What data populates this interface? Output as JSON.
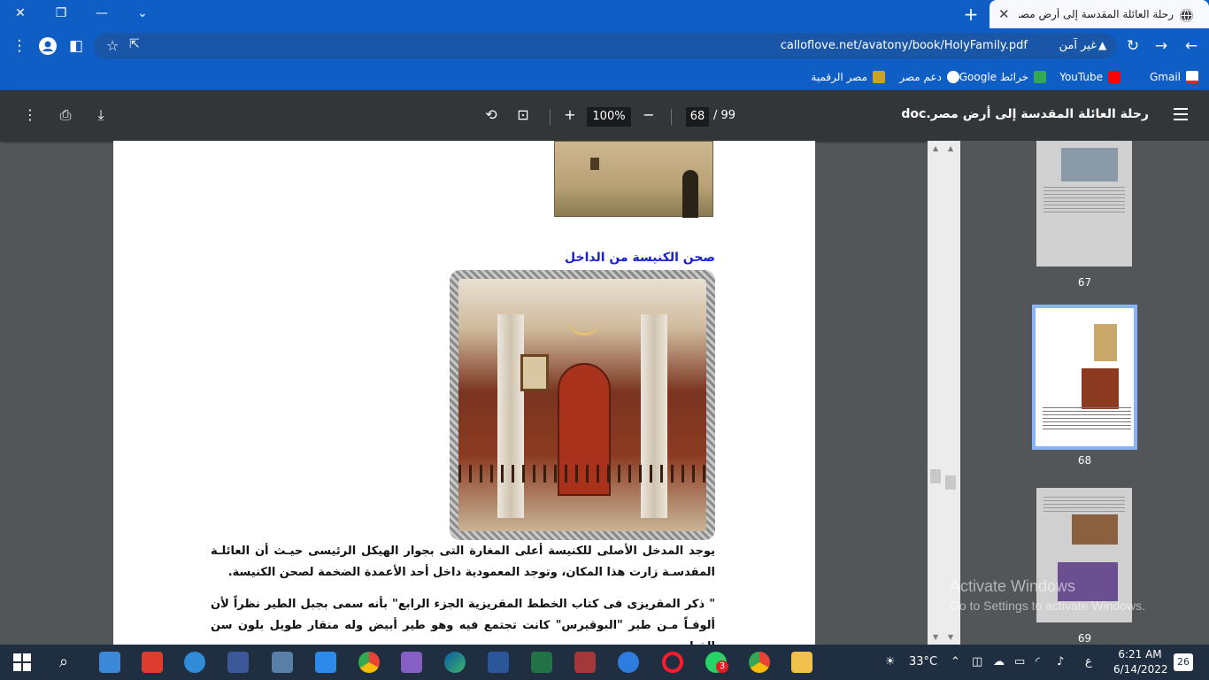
{
  "browser": {
    "tab_title": "رحلة العائلة المقدسة إلى أرض مصر",
    "new_tab_label": "+",
    "url": "calloflove.net/avatony/book/HolyFamily.pdf",
    "security_label": "غير آمن"
  },
  "bookmarks": [
    {
      "label": "Gmail",
      "color": "#d93025"
    },
    {
      "label": "YouTube",
      "color": "#ff0000"
    },
    {
      "label": "خرائط Google",
      "color": "#34a853"
    },
    {
      "label": "دعم مصر",
      "color": "#ffffff"
    },
    {
      "label": "مصر الرقمية",
      "color": "#c9a227"
    }
  ],
  "pdf": {
    "title": "رحلة العائلة المقدسة إلى أرض مصر.doc",
    "current_page": "68",
    "total_pages": "/ 99",
    "zoom": "100%",
    "heading": "صحن الكنيسة من الداخل",
    "paragraph_1": "يوجد المدخل الأصلى للكنيسة أعلى المغارة التى بجوار الهيكل الرئيسى حيـث أن العائلـة المقدسـة زارت هذا المكان، وتوجد المعمودية داخل أحد الأعمدة الضخمة لصحن الكنيسة.",
    "paragraph_2": "\" ذكر المقريزى فى كتاب الخطط المقريزية الجزء الرابع\" بأنه سمى بجبل الطير نظراً لأن ألوفـاً مـن طير \"البوقيرس\" كانت تجتمع فيه وهو طير أبيض وله منقار طويل بلون سن الفيل."
  },
  "thumbnails": [
    {
      "number": "67"
    },
    {
      "number": "68"
    },
    {
      "number": "69"
    }
  ],
  "watermark": {
    "line1": "Activate Windows",
    "line2": "Go to Settings to activate Windows."
  },
  "taskbar": {
    "weather": "33°C",
    "language": "ع",
    "time": "6:21 AM",
    "date": "6/14/2022",
    "notifications": "26",
    "whatsapp_badge": "3"
  }
}
